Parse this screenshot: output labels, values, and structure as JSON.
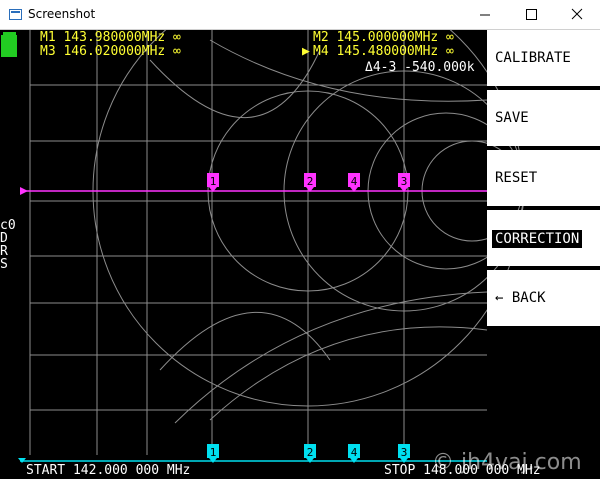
{
  "window": {
    "title": "Screenshot",
    "minimize_glyph": "—",
    "maximize_glyph": "☐",
    "close_glyph": "✕"
  },
  "markers_info": [
    {
      "label": "M1 143.980000MHz ∞"
    },
    {
      "label": "M3 146.020000MHz ∞"
    },
    {
      "label": "M2 145.000000MHz ∞"
    },
    {
      "label": "M4 145.480000MHz ∞"
    }
  ],
  "delta_info": "Δ4-3 -540.000k",
  "active_marker_glyph": "▶",
  "side_labels": [
    "c0",
    "D",
    "R",
    "S"
  ],
  "menu": [
    {
      "label": "CALIBRATE",
      "selected": false
    },
    {
      "label": "SAVE",
      "selected": false
    },
    {
      "label": "RESET",
      "selected": false
    },
    {
      "label": "CORRECTION",
      "selected": true
    },
    {
      "label": "← BACK",
      "selected": false
    }
  ],
  "trace_markers": [
    "1",
    "2",
    "4",
    "3"
  ],
  "freq": {
    "start": "START 142.000 000 MHz",
    "stop": "STOP 148.000 000 MHz"
  },
  "watermark": "© jh4vaj.com",
  "colors": {
    "grid": "#8c8c8c",
    "trace_magenta": "#ff33ff",
    "trace_cyan": "#00e0f0",
    "marker_text": "#ffff33",
    "battery": "#22cc22"
  }
}
